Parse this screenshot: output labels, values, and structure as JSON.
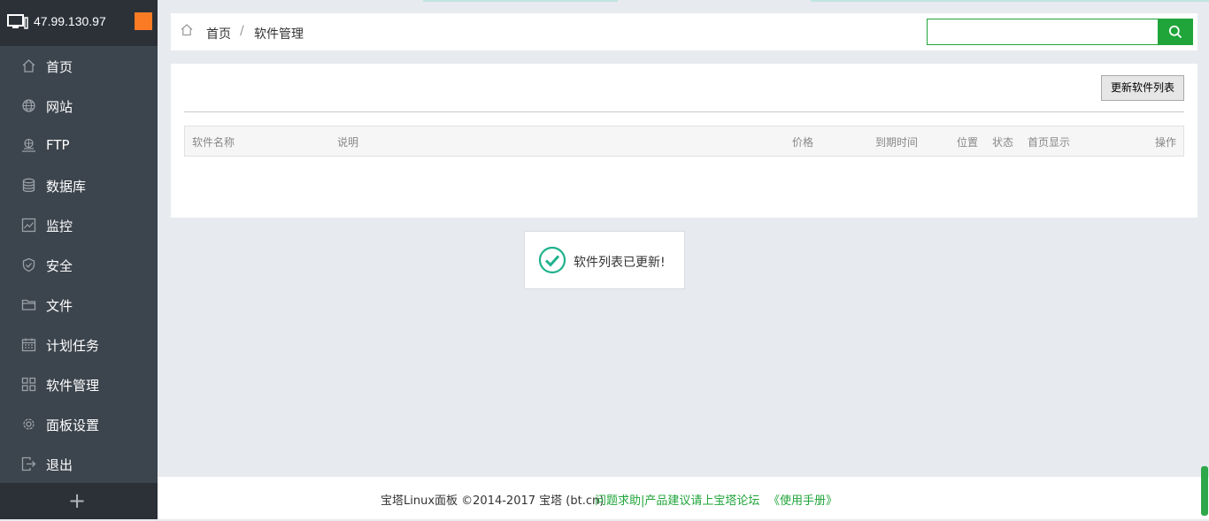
{
  "header": {
    "ip": "47.99.130.97"
  },
  "sidebar": {
    "items": [
      {
        "label": "首页",
        "icon": "home-icon"
      },
      {
        "label": "网站",
        "icon": "globe-icon"
      },
      {
        "label": "FTP",
        "icon": "ftp-icon"
      },
      {
        "label": "数据库",
        "icon": "database-icon"
      },
      {
        "label": "监控",
        "icon": "monitor-chart-icon"
      },
      {
        "label": "安全",
        "icon": "shield-icon"
      },
      {
        "label": "文件",
        "icon": "folder-icon"
      },
      {
        "label": "计划任务",
        "icon": "calendar-icon"
      },
      {
        "label": "软件管理",
        "icon": "grid-icon"
      },
      {
        "label": "面板设置",
        "icon": "gear-icon"
      },
      {
        "label": "退出",
        "icon": "logout-icon"
      }
    ],
    "add_label": "+"
  },
  "breadcrumb": {
    "home": "首页",
    "separator": "/",
    "current": "软件管理"
  },
  "search": {
    "value": "",
    "placeholder": ""
  },
  "toolbar": {
    "update_label": "更新软件列表"
  },
  "table": {
    "headers": [
      "软件名称",
      "说明",
      "价格",
      "到期时间",
      "位置",
      "状态",
      "首页显示",
      "操作"
    ]
  },
  "toast": {
    "message": "软件列表已更新!"
  },
  "footer": {
    "copyright": "宝塔Linux面板 ©2014-2017 宝塔 (bt.cn)",
    "help_link": "问题求助|产品建议请上宝塔论坛",
    "manual_link": "《使用手册》"
  },
  "colors": {
    "accent": "#20a53a",
    "sidebar_bg": "#3c444d",
    "sidebar_head": "#2c3138",
    "badge": "#fb7b24"
  }
}
